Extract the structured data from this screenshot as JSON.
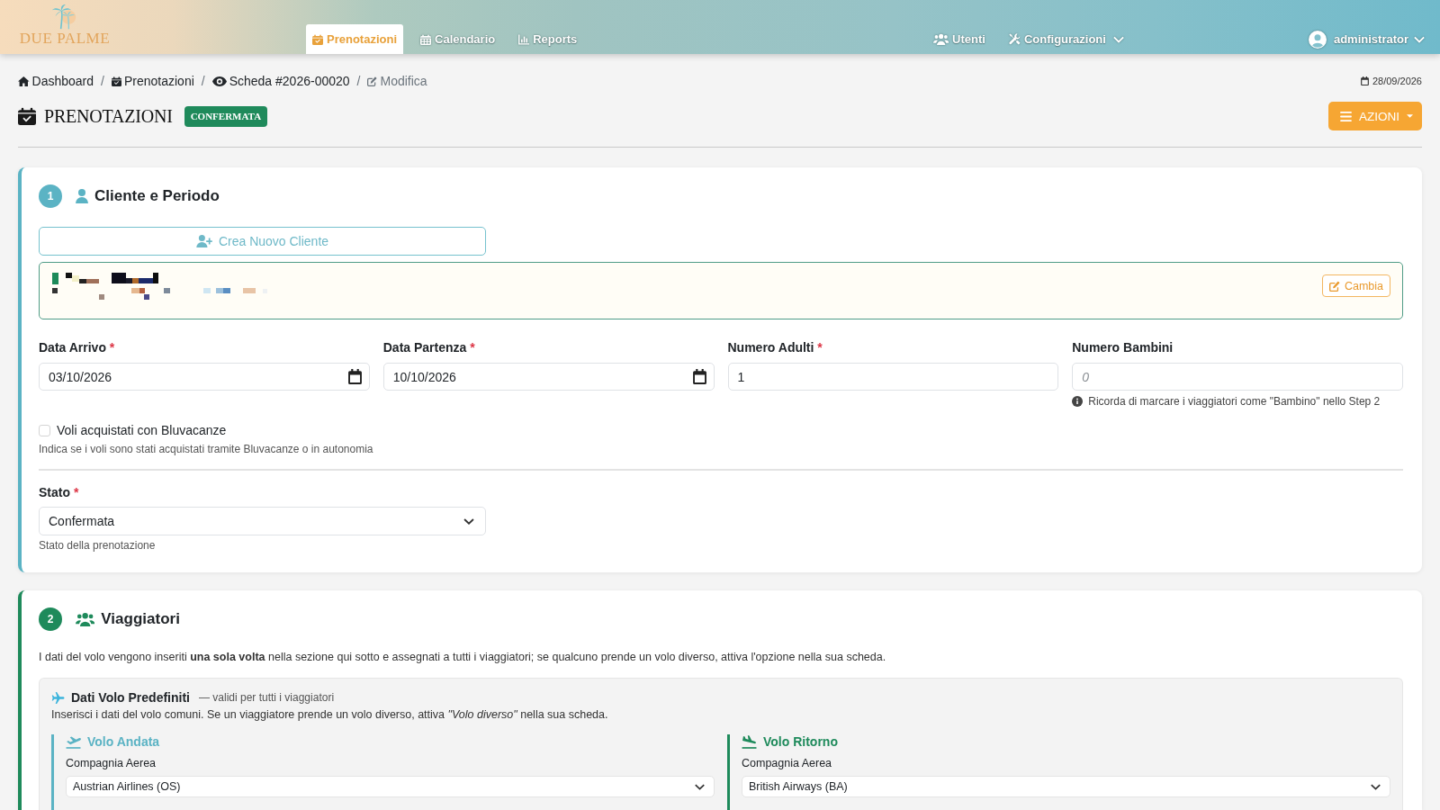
{
  "navbar": {
    "logo": {
      "text": "DUE PALME"
    },
    "tabs": [
      {
        "label": "Prenotazioni",
        "selected": true
      },
      {
        "label": "Calendario",
        "selected": false
      },
      {
        "label": "Reports",
        "selected": false
      }
    ],
    "right_menu": [
      {
        "label": "Utenti",
        "dropdown": false
      },
      {
        "label": "Configurazioni",
        "dropdown": true
      }
    ],
    "user": {
      "name": "administrator",
      "dropdown": true
    }
  },
  "breadcrumb": {
    "items": [
      {
        "label": "Dashboard",
        "current": false
      },
      {
        "separator": "/",
        "label": "Prenotazioni",
        "current": false
      },
      {
        "separator": "/",
        "label": "Scheda #2026-00020",
        "current": false
      },
      {
        "separator": "/",
        "label": "Modifica",
        "current": true
      }
    ],
    "date": "28/09/2026"
  },
  "page_header": {
    "title": "PRENOTAZIONI",
    "status_badge": "CONFERMATA",
    "actions_button": "AZIONI"
  },
  "sections": [
    {
      "kind": "client",
      "step": "1",
      "title": "Cliente e Periodo",
      "color": "#5bb3c4",
      "new_client_button": "Crea Nuovo Cliente",
      "customer_card": {
        "change_button": "Cambia"
      },
      "fields": [
        {
          "kind": "date",
          "label": "Data Arrivo",
          "required_mark": "*",
          "value": "03/10/2026"
        },
        {
          "kind": "date",
          "label": "Data Partenza",
          "required_mark": "*",
          "value": "10/10/2026"
        },
        {
          "kind": "number",
          "label": "Numero Adulti",
          "required_mark": "*",
          "value": "1"
        },
        {
          "kind": "number",
          "label": "Numero Bambini",
          "placeholder": "0",
          "hint": "Ricorda di marcare i viaggiatori come \"Bambino\" nello Step 2"
        }
      ],
      "checkbox": {
        "label": "Voli acquistati con Bluvacanze",
        "checked": false,
        "help": "Indica se i voli sono stati acquistati tramite Bluvacanze o in autonomia"
      },
      "status_select": {
        "label": "Stato",
        "required_mark": "*",
        "value": "Confermata",
        "help": "Stato della prenotazione"
      }
    },
    {
      "kind": "travellers",
      "step": "2",
      "title": "Viaggiatori",
      "color": "#1e8a5b",
      "intro": "I dati del volo vengono inseriti **una sola volta** nella sezione qui sotto e assegnati a tutti i viaggiatori; se qualcuno prende un volo diverso, attiva l'opzione nella sua scheda.",
      "default_flights": {
        "title": "Dati Volo Predefiniti",
        "subtitle": "— validi per tutti i viaggiatori",
        "description": "Inserisci i dati del volo comuni. Se un viaggiatore prende un volo diverso, attiva *\"Volo diverso\"* nella sua scheda.",
        "legs": [
          {
            "kind": "outbound",
            "title": "Volo Andata",
            "color": "#5bb3c4",
            "airline_label": "Compagnia Aerea",
            "airline": "Austrian Airlines (OS)"
          },
          {
            "kind": "return",
            "title": "Volo Ritorno",
            "color": "#1e8a5b",
            "airline_label": "Compagnia Aerea",
            "airline": "British Airways (BA)"
          }
        ]
      }
    }
  ]
}
